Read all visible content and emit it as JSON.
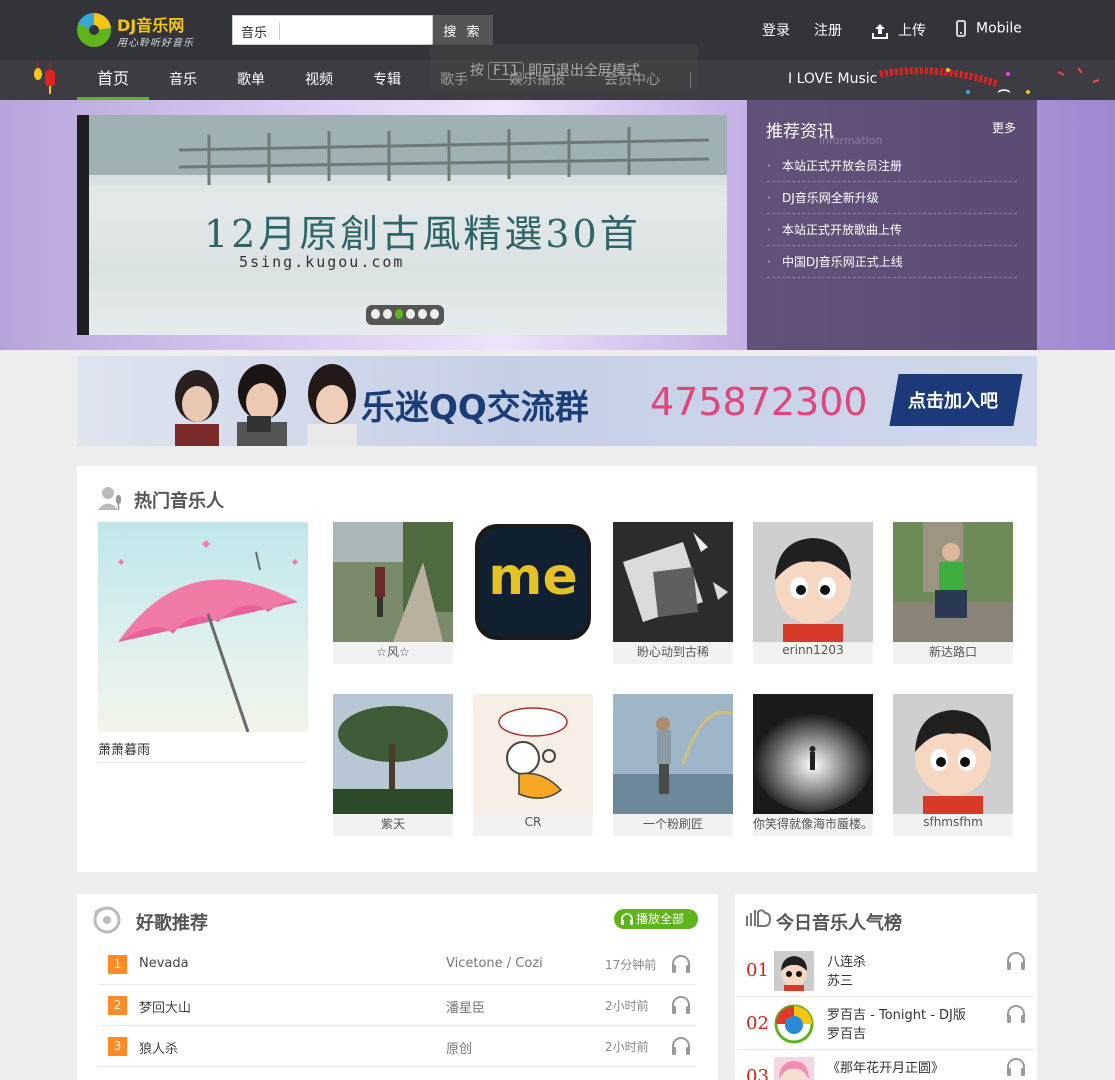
{
  "header": {
    "brand": "DJ音乐网",
    "tagline": "用心聆听好音乐",
    "search_scope": "音乐",
    "search_placeholder": "",
    "search_button": "搜 索",
    "login": "登录",
    "register": "注册",
    "upload": "上传",
    "mobile": "Mobile"
  },
  "nav": {
    "items": [
      "首页",
      "音乐",
      "歌单",
      "视频",
      "专辑",
      "歌手",
      "娱乐播报",
      "会员中心"
    ],
    "active_index": 0,
    "separator": "|",
    "slogan": "I LOVE Music"
  },
  "fullscreen_hint": {
    "prefix": "按",
    "key": "F11",
    "suffix": "即可退出全屏模式"
  },
  "hero": {
    "title": "12月原創古風精選30首",
    "subtitle": "5sing.kugou.com",
    "slide_count": 6,
    "active_slide": 2
  },
  "news": {
    "title": "推荐资讯",
    "title_en": "information",
    "more": "更多",
    "items": [
      "本站正式开放会员注册",
      "DJ音乐网全新升级",
      "本站正式开放歌曲上传",
      "中国DJ音乐网正式上线"
    ]
  },
  "qq_banner": {
    "title": "乐迷QQ交流群",
    "number": "475872300",
    "button": "点击加入吧"
  },
  "hot_musicians": {
    "title": "热门音乐人",
    "featured": "萧萧暮雨",
    "row1": [
      "☆风☆",
      "",
      "盼心动到古稀",
      "erinn1203",
      "新达路口"
    ],
    "row2": [
      "紫天",
      "CR",
      "一个粉刷匠",
      "你笑得就像海市蜃楼。",
      "sfhmsfhm"
    ]
  },
  "songs": {
    "title": "好歌推荐",
    "play_all": "播放全部",
    "rows": [
      {
        "num": "1",
        "title": "Nevada",
        "artist": "Vicetone / Cozi",
        "time": "17分钟前"
      },
      {
        "num": "2",
        "title": "梦回大山",
        "artist": "潘星臣",
        "time": "2小时前"
      },
      {
        "num": "3",
        "title": "狼人杀",
        "artist": "原创",
        "time": "2小时前"
      }
    ]
  },
  "chart": {
    "title": "今日音乐人气榜",
    "rows": [
      {
        "rank": "01",
        "song": "八连杀",
        "singer": "苏三"
      },
      {
        "rank": "02",
        "song": "罗百吉 - Tonight - DJ版",
        "singer": "罗百吉"
      },
      {
        "rank": "03",
        "song": "《那年花开月正圆》",
        "singer": ""
      }
    ]
  },
  "colors": {
    "topbar": "#33333a",
    "navbar": "#3c3c42",
    "accent_green": "#5fb41e",
    "rank_badge": "#ff8a26",
    "rank_red": "#d0211b",
    "qq_number": "#e2457a"
  }
}
